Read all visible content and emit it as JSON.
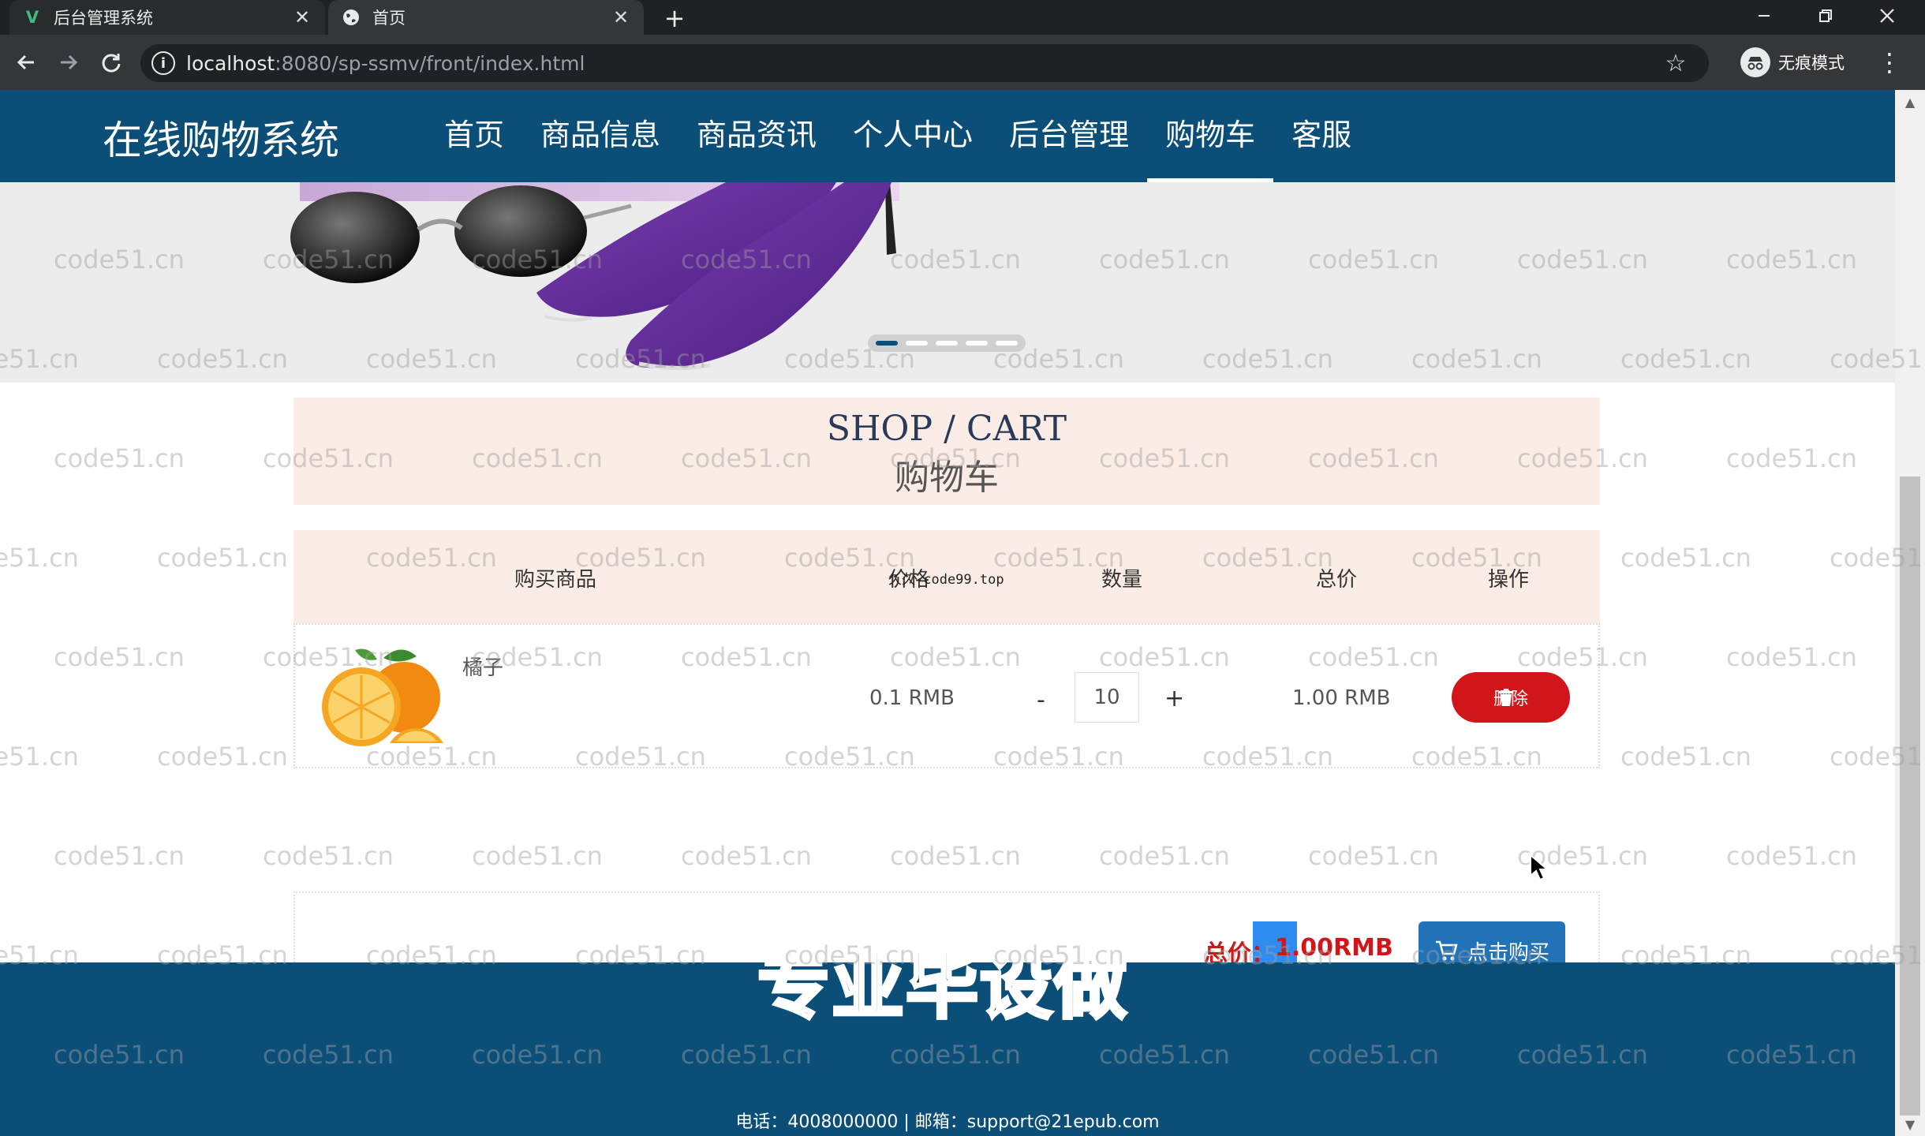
{
  "browser": {
    "tabs": [
      {
        "title": "后台管理系统",
        "favicon": "V",
        "close": "✕"
      },
      {
        "title": "首页",
        "favicon": "globe-icon",
        "close": "✕"
      }
    ],
    "new_tab": "+",
    "window_controls": {
      "minimize": "—",
      "restore": "❐",
      "close": "✕"
    },
    "url_host": "localhost",
    "url_path": ":8080/sp-ssmv/front/index.html",
    "incognito_label": "无痕模式"
  },
  "site": {
    "brand": "在线购物系统",
    "nav": [
      "首页",
      "商品信息",
      "商品资讯",
      "个人中心",
      "后台管理",
      "购物车",
      "客服"
    ],
    "active_nav": "购物车"
  },
  "carousel": {
    "slides": 5,
    "active": 0
  },
  "cart": {
    "title_en": "SHOP / CART",
    "title_zh": "购物车",
    "headers": {
      "product": "购买商品",
      "price": "价格",
      "qty": "数量",
      "total": "总价",
      "action": "操作"
    },
    "items": [
      {
        "name": "橘子",
        "price": "0.1 RMB",
        "minus": "-",
        "qty": "10",
        "plus": "+",
        "total": "1.00 RMB",
        "delete_label": "删除"
      }
    ],
    "summary_label": "总价：",
    "summary_value": "1.00RMB",
    "buy_label": "点击购买"
  },
  "footer": {
    "contact": "电话：4008000000 | 邮箱：support@21epub.com"
  },
  "overlays": {
    "promo": "专业毕设做",
    "watermark": "code51.cn",
    "stray_text": "久久-code99.top"
  },
  "colors": {
    "header": "#0b4f78",
    "danger": "#d0151b",
    "buy": "#2272b8",
    "cart_bg": "#fcece6"
  }
}
